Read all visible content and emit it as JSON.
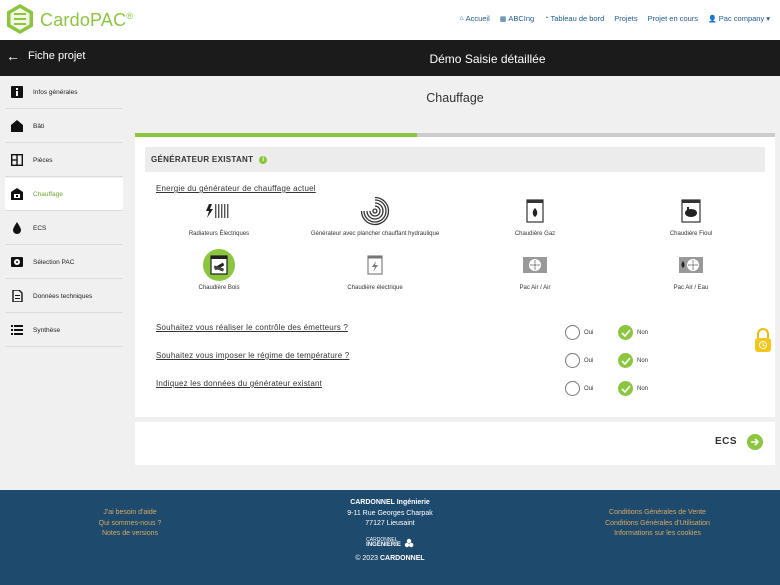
{
  "brand": {
    "name": "CardoPAC",
    "mark": "®"
  },
  "nav": [
    {
      "label": "Accueil",
      "icon": "home-icon",
      "glyph": "⌂"
    },
    {
      "label": "ABCIng",
      "icon": "book-icon",
      "glyph": "▦"
    },
    {
      "label": "Tableau de bord",
      "icon": "dashboard-icon",
      "glyph": "◔"
    },
    {
      "label": "Projets",
      "icon": "",
      "glyph": ""
    },
    {
      "label": "Projet en cours",
      "icon": "",
      "glyph": ""
    },
    {
      "label": "Pac company",
      "icon": "user-icon",
      "glyph": "👤",
      "caret": "▾"
    }
  ],
  "header": {
    "back_arrow": "←",
    "back_label": "Fiche projet",
    "title": "Démo Saisie détaillée"
  },
  "sidebar": {
    "items": [
      {
        "label": "Infos générales",
        "icon": "info-icon"
      },
      {
        "label": "Bâti",
        "icon": "house-icon"
      },
      {
        "label": "Pièces",
        "icon": "rooms-icon"
      },
      {
        "label": "Chauffage",
        "icon": "heating-icon",
        "active": true
      },
      {
        "label": "ECS",
        "icon": "drop-icon"
      },
      {
        "label": "Sélection PAC",
        "icon": "heatpump-icon"
      },
      {
        "label": "Données techniques",
        "icon": "document-icon"
      },
      {
        "label": "Synthèse",
        "icon": "list-icon"
      }
    ]
  },
  "page": {
    "title": "Chauffage",
    "progress_fraction": 0.44
  },
  "section": {
    "heading": "GÉNÉRATEUR EXISTANT",
    "info_glyph": "i",
    "energy_label": "Energie du générateur de chauffage actuel",
    "options": [
      {
        "label": "Radiateurs Électriques",
        "icon": "electric-radiator-icon"
      },
      {
        "label": "Générateur avec plancher chauffant hydraulique",
        "icon": "floor-heating-icon"
      },
      {
        "label": "Chaudière Gaz",
        "icon": "gas-boiler-icon"
      },
      {
        "label": "Chaudière Fioul",
        "icon": "oil-boiler-icon"
      },
      {
        "label": "Chaudière Bois",
        "icon": "wood-boiler-icon",
        "selected": true
      },
      {
        "label": "Chaudière électrique",
        "icon": "electric-boiler-icon"
      },
      {
        "label": "Pac Air / Air",
        "icon": "air-air-heatpump-icon"
      },
      {
        "label": "Pac Air / Eau",
        "icon": "air-water-heatpump-icon"
      }
    ],
    "questions": [
      {
        "text": "Souhaitez vous réaliser le contrôle des émetteurs ?",
        "yes": "Oui",
        "no": "Non",
        "value": "Non"
      },
      {
        "text": "Souhaitez vous imposer le régime de température ?",
        "yes": "Oui",
        "no": "Non",
        "value": "Non"
      },
      {
        "text": "Indiquez les données du générateur existant",
        "yes": "Oui",
        "no": "Non",
        "value": "Non"
      }
    ]
  },
  "next": {
    "label": "ECS"
  },
  "footer": {
    "left": [
      "J'ai besoin d'aide",
      "Qui sommes-nous ?",
      "Notes de versions"
    ],
    "company": "CARDONNEL Ingénierie",
    "address1": "9-11 Rue Georges Charpak",
    "address2": "77127 Lieusaint",
    "logo_small": "CARDONNEL",
    "logo_big": "INGÉNIERIE",
    "copyright_prefix": "© 2023",
    "copyright_name": "CARDONNEL",
    "right": [
      "Conditions Générales de Vente",
      "Conditions Générales d'Utilisation",
      "Informations sur les cookies"
    ]
  },
  "colors": {
    "accent": "#8cc63f",
    "dark": "#1b1b1b",
    "footer": "#1e4a6e",
    "link": "#1f5a8e",
    "footer_link": "#d9a861"
  }
}
